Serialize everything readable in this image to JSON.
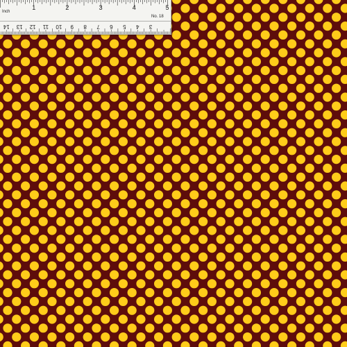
{
  "fabric": {
    "background_color": "#5e0d0b",
    "dot_color": "#ffcc1a",
    "pattern": "staggered polka dots"
  },
  "ruler": {
    "inch_unit_label": "Inch",
    "inch_numbers": [
      "1",
      "2",
      "3",
      "4",
      "5"
    ],
    "model_label": "No. 18",
    "cm_numbers": [
      "14",
      "13",
      "12",
      "11",
      "10",
      "9",
      "8",
      "7",
      "6",
      "5",
      "4",
      "3"
    ]
  }
}
